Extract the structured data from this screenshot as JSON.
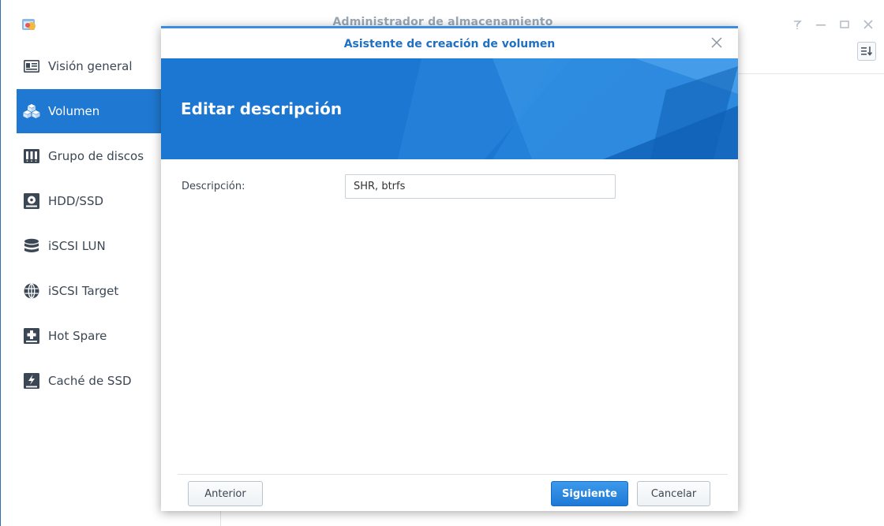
{
  "app": {
    "title": "Administrador de almacenamiento",
    "controls": [
      "help-icon",
      "minimize-icon",
      "maximize-icon",
      "close-icon"
    ]
  },
  "sidebar": {
    "items": [
      {
        "label": "Visión general",
        "icon": "overview-icon",
        "active": false
      },
      {
        "label": "Volumen",
        "icon": "volume-icon",
        "active": true
      },
      {
        "label": "Grupo de discos",
        "icon": "disk-group-icon",
        "active": false
      },
      {
        "label": "HDD/SSD",
        "icon": "hdd-icon",
        "active": false
      },
      {
        "label": "iSCSI LUN",
        "icon": "database-icon",
        "active": false
      },
      {
        "label": "iSCSI Target",
        "icon": "globe-icon",
        "active": false
      },
      {
        "label": "Hot Spare",
        "icon": "hot-spare-icon",
        "active": false
      },
      {
        "label": "Caché de SSD",
        "icon": "ssd-cache-icon",
        "active": false
      }
    ]
  },
  "modal": {
    "title": "Asistente de creación de volumen",
    "heading": "Editar descripción",
    "field_label": "Descripción:",
    "field_value": "SHR, btrfs",
    "buttons": {
      "previous": "Anterior",
      "next": "Siguiente",
      "cancel": "Cancelar"
    }
  },
  "colors": {
    "accent": "#1f78d1",
    "banner": "#1c77d3",
    "title_text": "#1f6fc2"
  }
}
